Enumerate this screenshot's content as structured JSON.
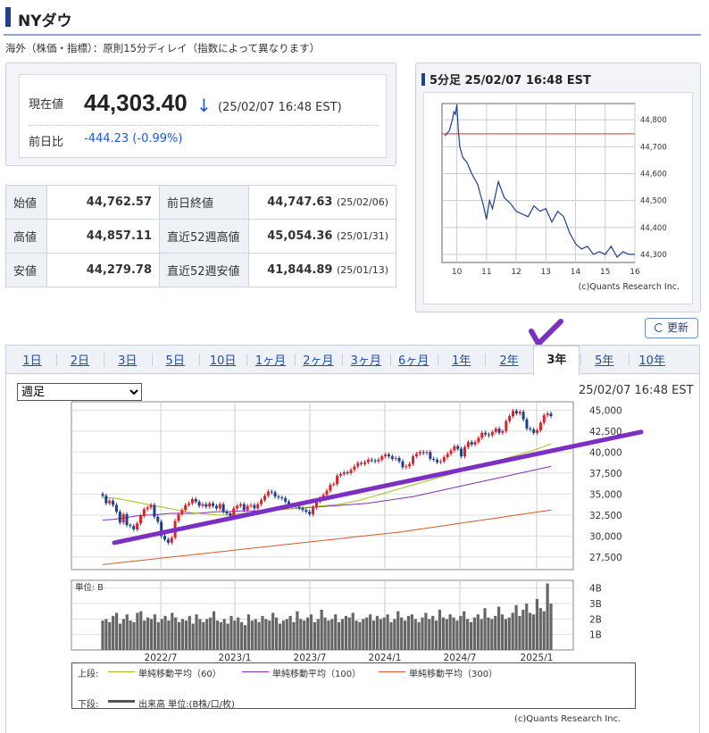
{
  "header": {
    "title": "NYダウ",
    "note": "海外（株価・指標）：原則15分ディレイ（指数によって異なります）"
  },
  "price": {
    "label": "現在値",
    "value": "44,303.40",
    "arrow": "↓",
    "time": "(25/02/07 16:48 EST)",
    "change_label": "前日比",
    "change": "-444.23 (-0.99%)"
  },
  "stats": [
    {
      "k": "始値",
      "v": "44,762.57",
      "k2": "前日終値",
      "v2": "44,747.63",
      "d2": "(25/02/06)"
    },
    {
      "k": "高値",
      "v": "44,857.11",
      "k2": "直近52週高値",
      "v2": "45,054.36",
      "d2": "(25/01/31)"
    },
    {
      "k": "安値",
      "v": "44,279.78",
      "k2": "直近52週安値",
      "v2": "41,844.89",
      "d2": "(25/01/13)"
    }
  ],
  "intraday": {
    "title": "5分足 25/02/07 16:48 EST",
    "credit": "(c)Quants Research Inc.",
    "x_ticks": [
      "10",
      "11",
      "12",
      "13",
      "14",
      "15",
      "16"
    ],
    "y_ticks": [
      "44,800",
      "44,700",
      "44,600",
      "44,500",
      "44,400",
      "44,300"
    ]
  },
  "refresh_label": "更新",
  "tabs": [
    "1日",
    "2日",
    "3日",
    "5日",
    "10日",
    "1ヶ月",
    "2ヶ月",
    "3ヶ月",
    "6ヶ月",
    "1年",
    "2年",
    "3年",
    "5年",
    "10年"
  ],
  "selected_tab": "3年",
  "chart": {
    "select_value": "週足",
    "time": "25/02/07 16:48 EST",
    "y_ticks": [
      "45,000",
      "42,500",
      "40,000",
      "37,500",
      "35,000",
      "32,500",
      "30,000",
      "27,500"
    ],
    "vol_unit": "単位: B",
    "vol_ticks": [
      "4B",
      "3B",
      "2B",
      "1B"
    ],
    "x_ticks": [
      "2022/7",
      "2023/1",
      "2023/7",
      "2024/1",
      "2024/7",
      "2025/1"
    ]
  },
  "legend": {
    "upper": "上段:",
    "ma60": "単純移動平均（60）",
    "ma100": "単純移動平均（100）",
    "ma300": "単純移動平均（300）",
    "lower": "下段:",
    "vol": "出来高 単位:(B株/口/枚)"
  },
  "credit": "(c)Quants Research Inc.",
  "colors": {
    "up": "#d8232a",
    "down": "#1b3f8f",
    "ma60": "#9fc21a",
    "ma100": "#8a2ab5",
    "ma300": "#d65a2a",
    "annot": "#7d2fc4"
  },
  "chart_data": [
    {
      "type": "line",
      "title": "5分足 25/02/07 16:48 EST",
      "x_range": [
        9.5,
        16
      ],
      "ylim": [
        44270,
        44860
      ],
      "x": [
        9.6,
        9.75,
        9.85,
        9.9,
        9.95,
        10.0,
        10.05,
        10.1,
        10.2,
        10.35,
        10.5,
        10.7,
        10.8,
        10.9,
        11.0,
        11.1,
        11.2,
        11.3,
        11.4,
        11.6,
        11.8,
        12.0,
        12.2,
        12.4,
        12.6,
        12.8,
        13.0,
        13.2,
        13.4,
        13.6,
        13.8,
        14.0,
        14.2,
        14.4,
        14.6,
        14.8,
        15.0,
        15.2,
        15.4,
        15.6,
        15.8,
        16.0
      ],
      "y": [
        44740,
        44760,
        44800,
        44830,
        44820,
        44857,
        44760,
        44700,
        44660,
        44640,
        44600,
        44560,
        44520,
        44480,
        44430,
        44500,
        44470,
        44520,
        44570,
        44510,
        44490,
        44460,
        44450,
        44440,
        44480,
        44460,
        44470,
        44420,
        44460,
        44440,
        44380,
        44340,
        44320,
        44330,
        44300,
        44310,
        44300,
        44330,
        44290,
        44310,
        44300,
        44300
      ],
      "ref_line": 44747.63
    },
    {
      "type": "candlestick",
      "period": "週足",
      "ylim": [
        26000,
        46000
      ],
      "x_ticks": [
        "2022/7",
        "2023/1",
        "2023/7",
        "2024/1",
        "2024/7",
        "2025/1"
      ],
      "close": [
        34800,
        33900,
        34200,
        33700,
        32900,
        31600,
        32600,
        31300,
        31200,
        30800,
        31500,
        32400,
        33200,
        33400,
        33700,
        32300,
        31700,
        30000,
        29600,
        29200,
        29800,
        31800,
        32600,
        33100,
        33700,
        33900,
        34400,
        34100,
        33600,
        33800,
        33500,
        33900,
        33600,
        33300,
        33800,
        32900,
        32700,
        32400,
        33300,
        33600,
        33800,
        33100,
        33600,
        33700,
        33300,
        33800,
        34300,
        34800,
        35300,
        35200,
        34700,
        34600,
        34500,
        34100,
        33700,
        33600,
        33500,
        33300,
        33100,
        32900,
        32600,
        33400,
        34100,
        34500,
        34900,
        35400,
        36100,
        36200,
        37200,
        37400,
        37600,
        37500,
        37900,
        38300,
        38700,
        38600,
        38800,
        39100,
        39000,
        38900,
        39100,
        39500,
        39700,
        39500,
        39200,
        39300,
        38900,
        38200,
        38300,
        38600,
        39500,
        39800,
        40000,
        39900,
        40000,
        39200,
        39100,
        38800,
        38900,
        39400,
        39800,
        40200,
        40700,
        40400,
        39500,
        40600,
        41200,
        40900,
        41200,
        41700,
        42300,
        42100,
        42000,
        42400,
        42800,
        42300,
        42500,
        43700,
        44300,
        44900,
        44600,
        44800,
        43900,
        42800,
        42700,
        42300,
        42600,
        43500,
        44400,
        44600,
        44300
      ],
      "ma60": [
        34600,
        34550,
        34400,
        34200,
        34000,
        33800,
        33600,
        33400,
        33200,
        33000,
        32800,
        32700,
        32600,
        32500,
        32500,
        32600,
        32700,
        32800,
        32900,
        33000,
        33100,
        33200,
        33300,
        33400,
        33500,
        33600,
        33700,
        33800,
        34000,
        34200,
        34500,
        34800,
        35100,
        35400,
        35700,
        36000,
        36300,
        36600,
        36900,
        37200,
        37500,
        37800,
        38100,
        38400,
        38700,
        39000,
        39300,
        39600,
        39900,
        40200,
        40600,
        41000
      ],
      "ma100": [
        31900,
        32000,
        32200,
        32400,
        32500,
        32600,
        32700,
        32700,
        32700,
        32800,
        32900,
        32900,
        33000,
        33000,
        33000,
        33100,
        33200,
        33300,
        33400,
        33500,
        33600,
        33700,
        33800,
        33900,
        34100,
        34300,
        34500,
        34700,
        35000,
        35300,
        35600,
        35900,
        36200,
        36500,
        36800,
        37100,
        37400,
        37700,
        38000,
        38300
      ],
      "ma300": [
        26600,
        26750,
        26900,
        27050,
        27200,
        27350,
        27500,
        27650,
        27800,
        27950,
        28100,
        28250,
        28400,
        28550,
        28700,
        28850,
        29000,
        29150,
        29300,
        29450,
        29600,
        29750,
        29900,
        30050,
        30200,
        30350,
        30500,
        30700,
        30900,
        31100,
        31300,
        31500,
        31700,
        31900,
        32100,
        32300,
        32500,
        32700,
        32900,
        33100
      ],
      "trendline": [
        29200,
        42400
      ]
    },
    {
      "type": "bar",
      "title": "出来高",
      "ylim": [
        0,
        4.5
      ],
      "unit": "B",
      "values": [
        1.9,
        2.0,
        1.8,
        2.2,
        2.4,
        1.7,
        2.0,
        2.3,
        1.9,
        1.8,
        2.4,
        2.5,
        1.9,
        2.1,
        2.0,
        2.3,
        1.8,
        2.0,
        2.2,
        1.9,
        2.4,
        2.1,
        1.8,
        2.0,
        1.9,
        2.2,
        1.7,
        2.3,
        2.0,
        1.8,
        2.0,
        2.1,
        2.5,
        1.9,
        1.8,
        2.0,
        1.7,
        2.2,
        1.9,
        2.1,
        1.8,
        1.6,
        2.3,
        1.9,
        2.0,
        1.8,
        2.2,
        2.0,
        1.9,
        2.4,
        2.1,
        1.7,
        1.9,
        2.0,
        2.2,
        1.8,
        2.5,
        2.0,
        1.9,
        2.1,
        2.3,
        1.8,
        2.0,
        2.6,
        2.1,
        1.9,
        2.0,
        2.3,
        1.8,
        2.0,
        2.2,
        2.1,
        2.4,
        1.9,
        1.8,
        2.0,
        2.1,
        2.3,
        1.9,
        2.2,
        2.0,
        2.1,
        2.3,
        1.8,
        2.0,
        2.5,
        2.1,
        1.9,
        2.2,
        2.3,
        2.0,
        1.8,
        2.1,
        2.4,
        2.0,
        2.2,
        1.9,
        2.6,
        2.1,
        2.0,
        2.3,
        2.1,
        1.9,
        2.2,
        2.5,
        2.0,
        1.8,
        2.1,
        2.3,
        2.0,
        2.7,
        2.1,
        2.0,
        2.2,
        2.8,
        2.3,
        2.0,
        2.1,
        2.4,
        2.9,
        2.2,
        2.6,
        3.0,
        2.4,
        2.3,
        3.3,
        2.7,
        2.5,
        4.3,
        3.0
      ]
    }
  ]
}
